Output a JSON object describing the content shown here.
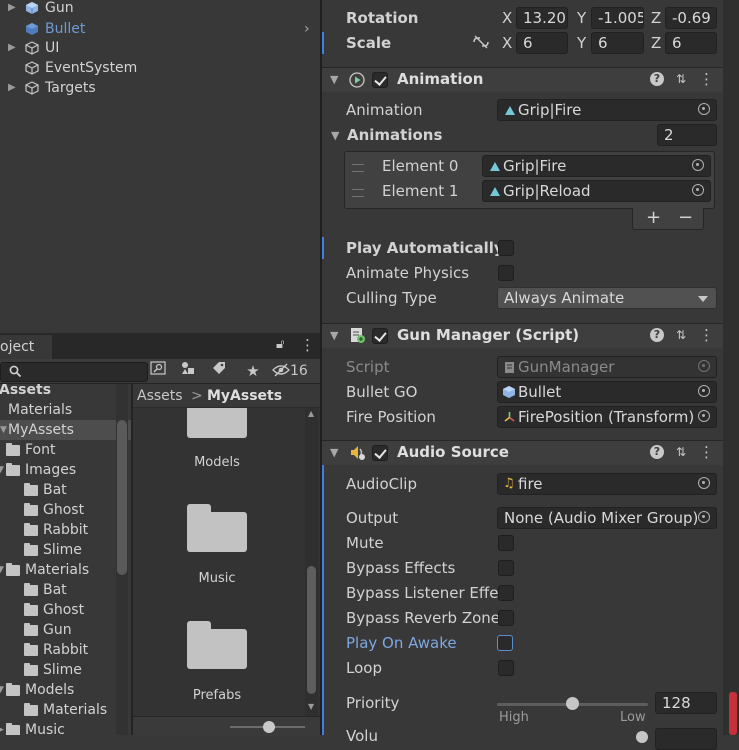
{
  "hierarchy": {
    "items": [
      {
        "label": "Gun",
        "expandable": true,
        "selected": false
      },
      {
        "label": "Bullet",
        "expandable": false,
        "selected": true
      },
      {
        "label": "UI",
        "expandable": true,
        "selected": false
      },
      {
        "label": "EventSystem",
        "expandable": false,
        "selected": false
      },
      {
        "label": "Targets",
        "expandable": true,
        "selected": false
      }
    ]
  },
  "project": {
    "tab_label": "oject",
    "hidden_count": "16",
    "breadcrumb": {
      "root": "Assets",
      "separator": ">",
      "current": "MyAssets"
    },
    "tree": [
      {
        "label": "Assets",
        "bold": true
      },
      {
        "label": "Materials"
      },
      {
        "label": "MyAssets",
        "selected": true
      },
      {
        "label": "Font"
      },
      {
        "label": "Images"
      },
      {
        "label": "Bat"
      },
      {
        "label": "Ghost"
      },
      {
        "label": "Rabbit"
      },
      {
        "label": "Slime"
      },
      {
        "label": "Materials"
      },
      {
        "label": "Bat"
      },
      {
        "label": "Ghost"
      },
      {
        "label": "Gun"
      },
      {
        "label": "Rabbit"
      },
      {
        "label": "Slime"
      },
      {
        "label": "Models"
      },
      {
        "label": "Materials"
      },
      {
        "label": "Music"
      }
    ],
    "folders": [
      "Models",
      "Music",
      "Prefabs"
    ]
  },
  "inspector": {
    "transform": {
      "rotation_label": "Rotation",
      "rotation": {
        "x": "13.20",
        "y": "-1.005",
        "z": "-0.69"
      },
      "scale_label": "Scale",
      "scale": {
        "x": "6",
        "y": "6",
        "z": "6"
      },
      "axis_x": "X",
      "axis_y": "Y",
      "axis_z": "Z"
    },
    "animation": {
      "header": "Animation",
      "animation_label": "Animation",
      "animation_value": "Grip|Fire",
      "animations_label": "Animations",
      "animations_count": "2",
      "elements": [
        {
          "label": "Element 0",
          "value": "Grip|Fire"
        },
        {
          "label": "Element 1",
          "value": "Grip|Reload"
        }
      ],
      "plus": "+",
      "minus": "−",
      "play_auto_label": "Play Automatically",
      "animate_physics_label": "Animate Physics",
      "culling_label": "Culling Type",
      "culling_value": "Always Animate"
    },
    "gun_manager": {
      "header": "Gun Manager (Script)",
      "script_label": "Script",
      "script_value": "GunManager",
      "bullet_label": "Bullet GO",
      "bullet_value": "Bullet",
      "fire_label": "Fire Position",
      "fire_value": "FirePosition (Transform)"
    },
    "audio_source": {
      "header": "Audio Source",
      "clip_label": "AudioClip",
      "clip_value": "fire",
      "output_label": "Output",
      "output_value": "None (Audio Mixer Group)",
      "mute_label": "Mute",
      "bypass_effects_label": "Bypass Effects",
      "bypass_listener_label": "Bypass Listener Effe",
      "bypass_reverb_label": "Bypass Reverb Zone",
      "play_on_awake_label": "Play On Awake",
      "loop_label": "Loop",
      "priority_label": "Priority",
      "priority_value": "128",
      "priority_fraction": 0.5,
      "priority_high": "High",
      "priority_low": "Low",
      "volume_label": "Volu"
    }
  },
  "colors": {
    "accent": "#3d80df",
    "selected_text": "#6e9bd6",
    "scrollbar_thumb": "#c8303a"
  }
}
